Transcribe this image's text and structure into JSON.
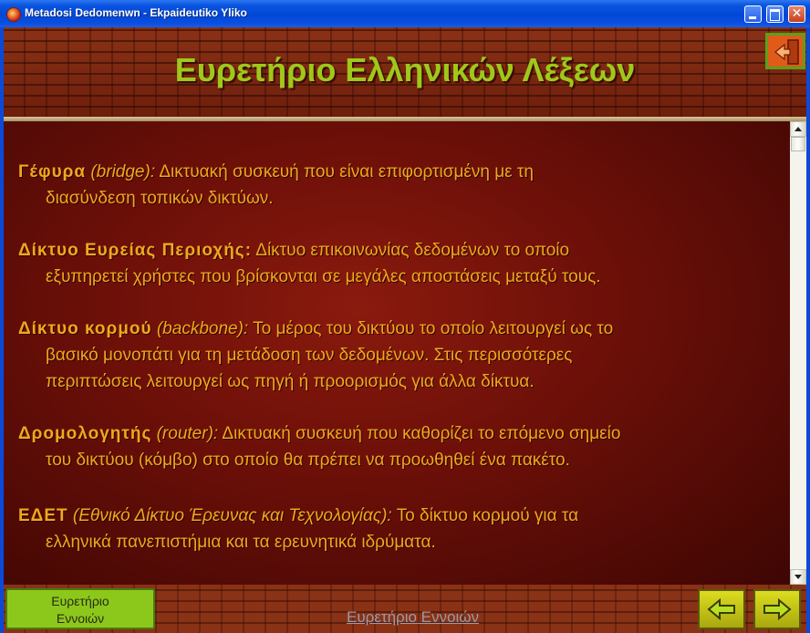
{
  "window": {
    "title": "Metadosi Dedomenwn - Ekpaideutiko Yliko",
    "icon": "app-icon",
    "controls": [
      "minimize-icon",
      "maximize-icon",
      "close-icon"
    ]
  },
  "header": {
    "title": "Ευρετήριο Ελληνικών Λέξεων",
    "title_color": "#9ec81a",
    "exit_icon": "exit-door-icon"
  },
  "entries": [
    {
      "term": "Γέφυρα",
      "english": "(bridge):",
      "line1": "Δικτυακή συσκευή που είναι επιφορτισμένη με τη",
      "lines": [
        "διασύνδεση τοπικών δικτύων."
      ]
    },
    {
      "term": "Δίκτυο Ευρείας Περιοχής:",
      "english": "",
      "line1": "Δίκτυο επικοινωνίας δεδομένων το οποίο",
      "lines": [
        "εξυπηρετεί χρήστες που βρίσκονται σε μεγάλες αποστάσεις μεταξύ τους."
      ]
    },
    {
      "term": "Δίκτυο κορμού",
      "english": "(backbone):",
      "line1": "Το μέρος του δικτύου το οποίο λειτουργεί ως το",
      "lines": [
        "βασικό μονοπάτι για τη μετάδοση των δεδομένων. Στις περισσότερες",
        "περιπτώσεις λειτουργεί ως πηγή ή προορισμός για άλλα δίκτυα."
      ]
    },
    {
      "term": "Δρομολογητής",
      "english": "(router):",
      "line1": "Δικτυακή συσκευή που καθορίζει το επόμενο σημείο",
      "lines": [
        "του δικτύου (κόμβο) στο οποίο θα πρέπει να προωθηθεί ένα πακέτο."
      ]
    },
    {
      "term": "ΕΔΕΤ",
      "english": "(Εθνικό Δίκτυο Έρευνας και Τεχνολογίας):",
      "line1": "Το δίκτυο κορμού για τα",
      "lines": [
        "ελληνικά πανεπιστήμια και τα ερευνητικά ιδρύματα."
      ]
    }
  ],
  "footer": {
    "index_button_line1": "Ευρετήριο",
    "index_button_line2": "Εννοιών",
    "link_text": "Ευρετήριο Εννοιών",
    "back_icon": "arrow-left-icon",
    "forward_icon": "arrow-right-icon"
  },
  "colors": {
    "text": "#f0a81c",
    "accent_green": "#8cc81c",
    "nav_yellow": "#dcdc20"
  }
}
